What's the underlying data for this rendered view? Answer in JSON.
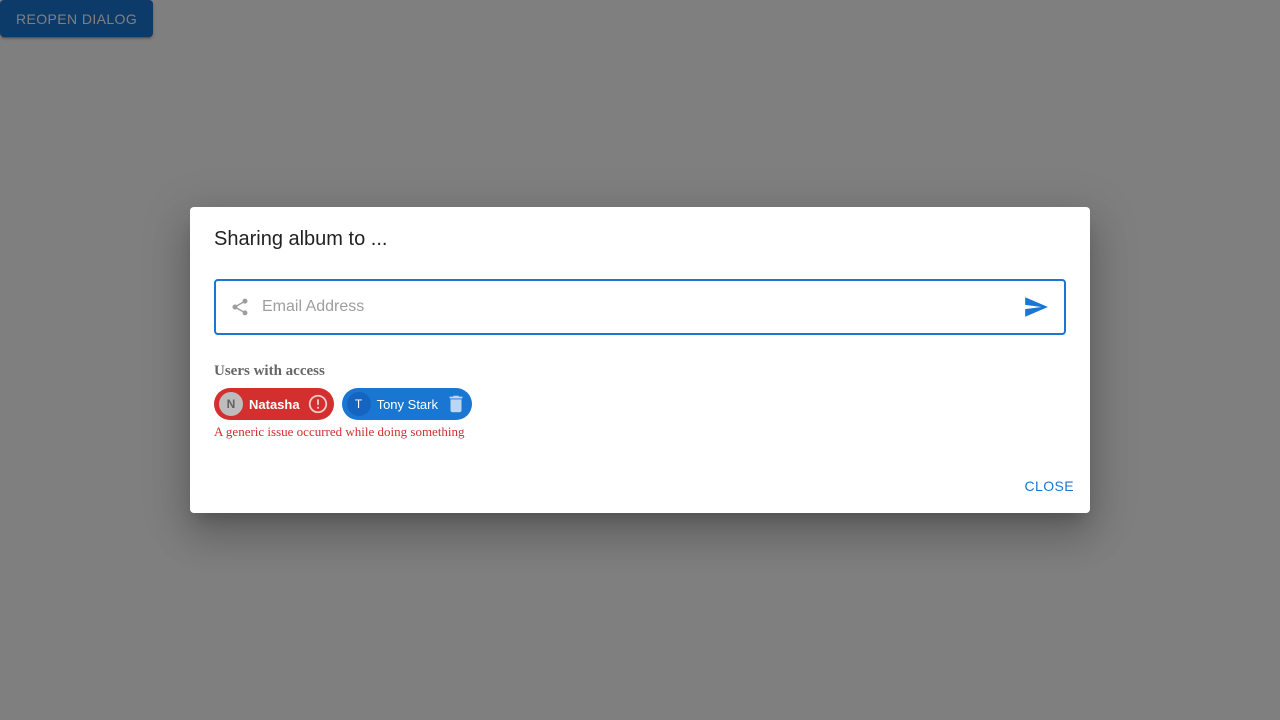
{
  "page": {
    "reopen_label": "Reopen Dialog"
  },
  "dialog": {
    "title": "Sharing album to ...",
    "email_input": {
      "value": "",
      "placeholder": "Email Address"
    },
    "users_label": "Users with access",
    "chips": [
      {
        "avatar": "N",
        "label": "Natasha",
        "status": "error",
        "action_icon": "error-outline-icon"
      },
      {
        "avatar": "T",
        "label": "Tony Stark",
        "status": "default",
        "action_icon": "trash-icon"
      }
    ],
    "error_message": "A generic issue occurred while doing something",
    "close_label": "Close"
  },
  "colors": {
    "primary": "#1976d2",
    "error": "#d32f2f",
    "backdrop": "rgba(0,0,0,0.5)"
  }
}
